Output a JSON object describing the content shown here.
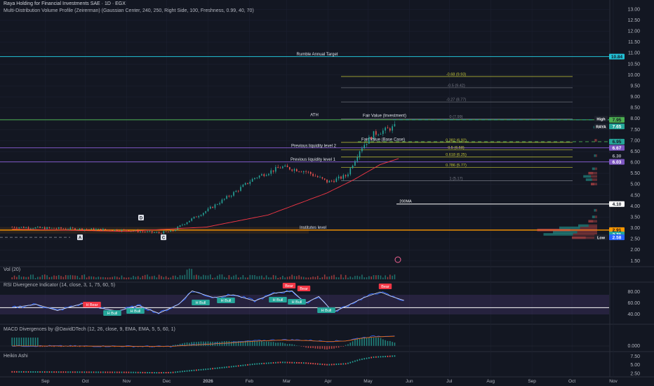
{
  "header": {
    "title": "Raya Holding for Financial Investments SAE · 1D · EGX",
    "subtitle": "Multi-Distribution Volume Profile (Zeirerman) (Gaussian Center, 240, 250, Right Side, 100, Freshness, 0.99, 40, 70)"
  },
  "panes": {
    "vol": "Vol (20)",
    "rsi": "RSI Divergence Indicator (14, close, 3, 1, 75, 60, 5)",
    "macd": "MACD Divergences by @DavidDTech (12, 26, close, 9, EMA, EMA, 5, 5, 60, 1)",
    "ha": "Heikin Ashi"
  },
  "colors": {
    "up": "#26a69a",
    "down": "#ef5350",
    "cyan": "#22c1d6",
    "purple": "#7e57c2",
    "orange": "#ff9800",
    "ma": "#f23645",
    "fib": "#c7c93a"
  },
  "chart_data": [
    {
      "type": "candlestick",
      "pane": "price",
      "ylim": [
        1.3,
        13.3
      ],
      "y_ticks": [
        "13.00",
        "12.50",
        "12.00",
        "11.50",
        "11.00",
        "10.50",
        "10.00",
        "9.50",
        "9.00",
        "8.50",
        "8.00",
        "7.50",
        "7.00",
        "6.50",
        "6.00",
        "5.50",
        "5.00",
        "4.50",
        "4.00",
        "3.50",
        "3.00",
        "2.50",
        "2.00",
        "1.50"
      ],
      "x_ticks": [
        "Sep",
        "Oct",
        "Nov",
        "Dec",
        "2026",
        "Feb",
        "Mar",
        "Apr",
        "May",
        "Jun",
        "Jul",
        "Aug",
        "Sep",
        "Oct",
        "Nov"
      ],
      "series": [
        {
          "name": "RAYA",
          "anchors": [
            [
              "2025-08-07",
              3.05
            ],
            [
              "2025-09-01",
              3.0
            ],
            [
              "2025-10-01",
              2.95
            ],
            [
              "2025-11-01",
              2.9
            ],
            [
              "2025-11-25",
              2.78
            ],
            [
              "2025-12-05",
              2.85
            ],
            [
              "2025-12-15",
              3.25
            ],
            [
              "2025-12-31",
              3.8
            ],
            [
              "2026-01-20",
              4.6
            ],
            [
              "2026-02-05",
              5.3
            ],
            [
              "2026-02-25",
              5.8
            ],
            [
              "2026-03-15",
              5.6
            ],
            [
              "2026-04-01",
              5.1
            ],
            [
              "2026-04-15",
              5.4
            ],
            [
              "2026-04-25",
              6.6
            ],
            [
              "2026-05-05",
              7.3
            ],
            [
              "2026-05-15",
              7.5
            ],
            [
              "2026-05-22",
              7.65
            ]
          ]
        },
        {
          "name": "200MA",
          "anchors": [
            [
              "2025-08-07",
              2.95
            ],
            [
              "2025-11-01",
              2.85
            ],
            [
              "2025-12-31",
              3.05
            ],
            [
              "2026-02-15",
              3.6
            ],
            [
              "2026-03-31",
              4.6
            ],
            [
              "2026-04-20",
              5.2
            ],
            [
              "2026-05-10",
              5.9
            ],
            [
              "2026-05-25",
              6.2
            ]
          ]
        }
      ],
      "levels": [
        {
          "label": "Rumble Annual Target",
          "value": 10.84,
          "tag": "10.84"
        },
        {
          "label": "ATH",
          "value": 7.95,
          "tag": "7.95"
        },
        {
          "label": "Fair Value (Investment)",
          "value": 7.95
        },
        {
          "label": "Fair Value (Base Case)",
          "value": 6.95,
          "tag": "6.95"
        },
        {
          "label": "Previous liquidity level 2",
          "value": 6.67,
          "tag": "6.67"
        },
        {
          "label": "Previous liquidity level 1",
          "value": 6.03,
          "tag": "6.03"
        },
        {
          "label": "200MA",
          "value": 4.1,
          "tag": "4.10"
        },
        {
          "label": "Institutes level",
          "value": 2.91,
          "tag": "2.91"
        }
      ],
      "fib_levels": [
        {
          "label": "-0.68 (9.93)",
          "value": 9.93
        },
        {
          "label": "-0.5 (9.42)",
          "value": 9.42
        },
        {
          "label": "-0.27 (8.77)",
          "value": 8.77
        },
        {
          "label": "0 (7.99)",
          "value": 7.99
        },
        {
          "label": "0.382 (6.92)",
          "value": 6.92
        },
        {
          "label": "0.5 (6.58)",
          "value": 6.58
        },
        {
          "label": "0.618 (6.25)",
          "value": 6.25
        },
        {
          "label": "0.786 (5.77)",
          "value": 5.77
        },
        {
          "label": "1 (5.17)",
          "value": 5.17
        }
      ],
      "price_tags": [
        {
          "label": "",
          "value": 8.01,
          "text": "8.01"
        },
        {
          "label": "High",
          "value": 8.0,
          "text": "8.00"
        },
        {
          "label": "RAYA",
          "value": 7.65,
          "text": "7.65"
        },
        {
          "label": "",
          "value": 6.3,
          "text": "6.30"
        },
        {
          "label": "",
          "value": 2.71,
          "text": "2.71"
        },
        {
          "label": "Low",
          "value": 2.58,
          "text": "2.58"
        }
      ],
      "point_labels": [
        "A",
        "D",
        "C"
      ]
    },
    {
      "type": "line",
      "pane": "rsi",
      "ylim": [
        25,
        95
      ],
      "y_ticks": [
        "80.00",
        "60.00",
        "40.00"
      ],
      "band": [
        40,
        75
      ],
      "level": 52,
      "series": [
        {
          "anchors": [
            [
              "2025-08-07",
              52
            ],
            [
              "2025-08-25",
              58
            ],
            [
              "2025-09-10",
              47
            ],
            [
              "2025-09-30",
              60
            ],
            [
              "2025-10-10",
              52
            ],
            [
              "2025-10-25",
              46
            ],
            [
              "2025-11-10",
              56
            ],
            [
              "2025-11-25",
              42
            ],
            [
              "2025-12-10",
              58
            ],
            [
              "2025-12-20",
              82
            ],
            [
              "2026-01-05",
              70
            ],
            [
              "2026-01-20",
              75
            ],
            [
              "2026-02-05",
              64
            ],
            [
              "2026-02-20",
              78
            ],
            [
              "2026-03-05",
              82
            ],
            [
              "2026-03-15",
              60
            ],
            [
              "2026-03-25",
              72
            ],
            [
              "2026-04-05",
              44
            ],
            [
              "2026-04-15",
              55
            ],
            [
              "2026-04-28",
              70
            ],
            [
              "2026-05-10",
              80
            ],
            [
              "2026-05-20",
              71
            ],
            [
              "2026-05-28",
              65
            ]
          ]
        }
      ],
      "badges": [
        "H Bear",
        "H Bull",
        "H Bull",
        "H Bull",
        "H Bull",
        "H Bull",
        "H Bull",
        "Bear",
        "Bear",
        "H Bull",
        "Bear"
      ]
    },
    {
      "type": "bar",
      "pane": "macd",
      "y_ticks": [
        "0.000"
      ],
      "series": [
        {
          "name": "MACD"
        },
        {
          "name": "Signal"
        }
      ]
    },
    {
      "type": "line",
      "pane": "heikin_ashi",
      "y_ticks": [
        "7.50",
        "5.00",
        "2.50"
      ]
    }
  ]
}
